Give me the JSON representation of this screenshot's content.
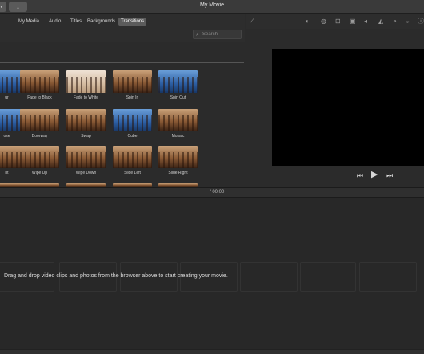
{
  "window": {
    "title": "My Movie"
  },
  "titlebar": {
    "back_glyph": "‹",
    "import_glyph": "↓"
  },
  "browser": {
    "tabs": [
      {
        "label": "My Media",
        "active": false
      },
      {
        "label": "Audio",
        "active": false
      },
      {
        "label": "Titles",
        "active": false
      },
      {
        "label": "Backgrounds",
        "active": false
      },
      {
        "label": "Transitions",
        "active": true
      }
    ],
    "search": {
      "placeholder": "Search",
      "value": ""
    },
    "transitions": [
      {
        "label": "ur",
        "style": "blue"
      },
      {
        "label": "Fade to Black",
        "style": "forest"
      },
      {
        "label": "Fade to White",
        "style": "forest-light"
      },
      {
        "label": "Spin In",
        "style": "forest"
      },
      {
        "label": "Spin Out",
        "style": "blue"
      },
      {
        "label": "ose",
        "style": "blue"
      },
      {
        "label": "Doorway",
        "style": "forest"
      },
      {
        "label": "Swap",
        "style": "forest"
      },
      {
        "label": "Cube",
        "style": "blue"
      },
      {
        "label": "Mosaic",
        "style": "forest"
      },
      {
        "label": "ht",
        "style": "forest"
      },
      {
        "label": "Wipe Up",
        "style": "forest"
      },
      {
        "label": "Wipe Down",
        "style": "forest"
      },
      {
        "label": "Slide Left",
        "style": "forest"
      },
      {
        "label": "Slide Right",
        "style": "forest"
      }
    ]
  },
  "viewer": {
    "toolbar_icons": [
      "magic-wand-icon",
      "color-balance-icon",
      "color-correction-icon",
      "crop-icon",
      "stabilization-icon",
      "volume-icon",
      "noise-reduction-icon",
      "speed-icon",
      "filter-icon",
      "info-icon"
    ],
    "controls": {
      "previous_glyph": "⏮",
      "play_glyph": "▶",
      "next_glyph": "⏭"
    }
  },
  "timeline": {
    "timecode": "/ 00:00",
    "hint": "Drag and drop video clips and photos from the browser above to start creating your movie."
  },
  "colors": {
    "background": "#2b2b2b",
    "active_tab": "#5b5b5b",
    "video": "#000000"
  }
}
